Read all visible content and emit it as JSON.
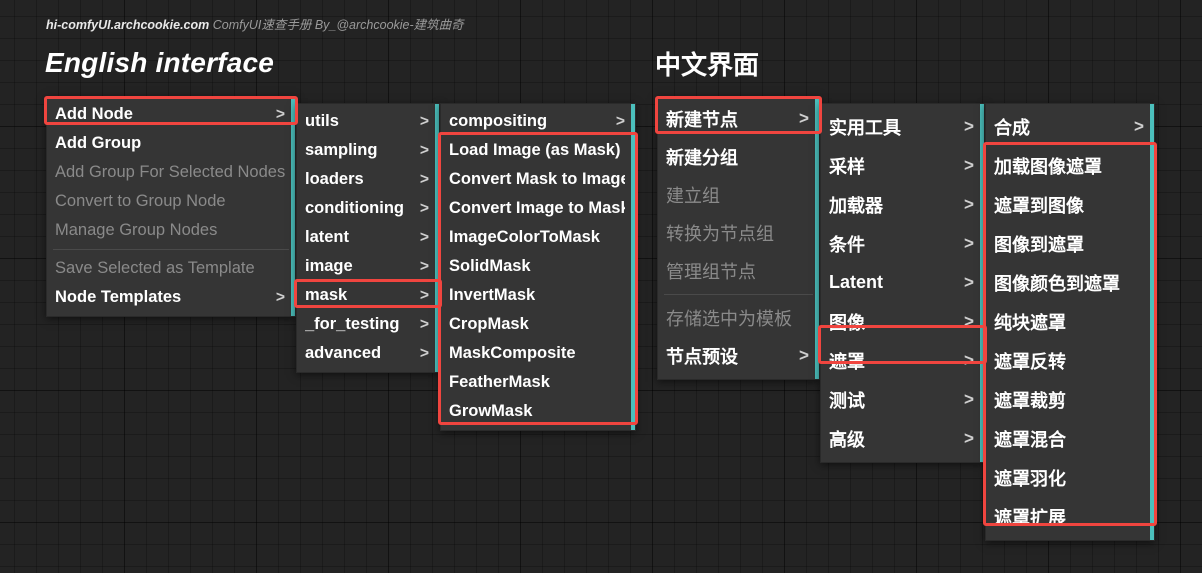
{
  "header": {
    "credit_bold": "hi-comfyUI.archcookie.com",
    "credit_rest": "ComfyUI速查手册 By_@archcookie-建筑曲奇",
    "title_en": "English interface",
    "title_zh": "中文界面"
  },
  "colors": {
    "canvas_bg": "#232323",
    "menu_bg": "#353535",
    "text_enabled": "#ffffff",
    "text_disabled": "#8a8a8a",
    "highlight_box": "#f0453f",
    "accent_strip": "#4bbfbc"
  },
  "icons": {
    "submenu_arrow": ">"
  },
  "english": {
    "column1": {
      "name": "root-context-menu",
      "items": [
        {
          "label": "Add Node",
          "arrow": ">",
          "enabled": true,
          "highlighted": true,
          "accent": true
        },
        {
          "label": "Add Group",
          "arrow": "",
          "enabled": true,
          "highlighted": false,
          "accent": false
        },
        {
          "label": "Add Group For Selected Nodes",
          "arrow": "",
          "enabled": false,
          "highlighted": false,
          "accent": false
        },
        {
          "label": "Convert to Group Node",
          "arrow": "",
          "enabled": false,
          "highlighted": false,
          "accent": false
        },
        {
          "label": "Manage Group Nodes",
          "arrow": "",
          "enabled": false,
          "highlighted": false,
          "accent": false
        },
        {
          "separator": true
        },
        {
          "label": "Save Selected as Template",
          "arrow": "",
          "enabled": false,
          "highlighted": false,
          "accent": false
        },
        {
          "label": "Node Templates",
          "arrow": ">",
          "enabled": true,
          "highlighted": false,
          "accent": true
        }
      ]
    },
    "column2": {
      "name": "add-node-categories",
      "items": [
        {
          "label": "utils",
          "arrow": ">",
          "enabled": true,
          "highlighted": false,
          "accent": true
        },
        {
          "label": "sampling",
          "arrow": ">",
          "enabled": true,
          "highlighted": false,
          "accent": true
        },
        {
          "label": "loaders",
          "arrow": ">",
          "enabled": true,
          "highlighted": false,
          "accent": true
        },
        {
          "label": "conditioning",
          "arrow": ">",
          "enabled": true,
          "highlighted": false,
          "accent": true
        },
        {
          "label": "latent",
          "arrow": ">",
          "enabled": true,
          "highlighted": false,
          "accent": true
        },
        {
          "label": "image",
          "arrow": ">",
          "enabled": true,
          "highlighted": false,
          "accent": true
        },
        {
          "label": "mask",
          "arrow": ">",
          "enabled": true,
          "highlighted": true,
          "accent": true
        },
        {
          "label": "_for_testing",
          "arrow": ">",
          "enabled": true,
          "highlighted": false,
          "accent": true
        },
        {
          "label": "advanced",
          "arrow": ">",
          "enabled": true,
          "highlighted": false,
          "accent": true
        }
      ]
    },
    "column3": {
      "name": "mask-node-list",
      "items": [
        {
          "label": "compositing",
          "arrow": ">",
          "enabled": true,
          "highlighted": false,
          "accent": true,
          "in_box": false
        },
        {
          "label": "Load Image (as Mask)",
          "arrow": "",
          "enabled": true,
          "highlighted": false,
          "accent": false,
          "in_box": true
        },
        {
          "label": "Convert Mask to Image",
          "arrow": "",
          "enabled": true,
          "highlighted": false,
          "accent": false,
          "in_box": true
        },
        {
          "label": "Convert Image to Mask",
          "arrow": "",
          "enabled": true,
          "highlighted": false,
          "accent": false,
          "in_box": true
        },
        {
          "label": "ImageColorToMask",
          "arrow": "",
          "enabled": true,
          "highlighted": false,
          "accent": false,
          "in_box": true
        },
        {
          "label": "SolidMask",
          "arrow": "",
          "enabled": true,
          "highlighted": false,
          "accent": false,
          "in_box": true
        },
        {
          "label": "InvertMask",
          "arrow": "",
          "enabled": true,
          "highlighted": false,
          "accent": false,
          "in_box": true
        },
        {
          "label": "CropMask",
          "arrow": "",
          "enabled": true,
          "highlighted": false,
          "accent": false,
          "in_box": true
        },
        {
          "label": "MaskComposite",
          "arrow": "",
          "enabled": true,
          "highlighted": false,
          "accent": false,
          "in_box": true
        },
        {
          "label": "FeatherMask",
          "arrow": "",
          "enabled": true,
          "highlighted": false,
          "accent": false,
          "in_box": true
        },
        {
          "label": "GrowMask",
          "arrow": "",
          "enabled": true,
          "highlighted": false,
          "accent": false,
          "in_box": true
        }
      ]
    }
  },
  "chinese": {
    "column1": {
      "name": "root-context-menu-zh",
      "items": [
        {
          "label": "新建节点",
          "arrow": ">",
          "enabled": true,
          "highlighted": true,
          "accent": true
        },
        {
          "label": "新建分组",
          "arrow": "",
          "enabled": true,
          "highlighted": false,
          "accent": false
        },
        {
          "label": "建立组",
          "arrow": "",
          "enabled": false,
          "highlighted": false,
          "accent": false
        },
        {
          "label": "转换为节点组",
          "arrow": "",
          "enabled": false,
          "highlighted": false,
          "accent": false
        },
        {
          "label": "管理组节点",
          "arrow": "",
          "enabled": false,
          "highlighted": false,
          "accent": false
        },
        {
          "separator": true
        },
        {
          "label": "存储选中为模板",
          "arrow": "",
          "enabled": false,
          "highlighted": false,
          "accent": false
        },
        {
          "label": "节点预设",
          "arrow": ">",
          "enabled": true,
          "highlighted": false,
          "accent": true
        }
      ]
    },
    "column2": {
      "name": "add-node-categories-zh",
      "items": [
        {
          "label": "实用工具",
          "arrow": ">",
          "enabled": true,
          "highlighted": false,
          "accent": true
        },
        {
          "label": "采样",
          "arrow": ">",
          "enabled": true,
          "highlighted": false,
          "accent": true
        },
        {
          "label": "加载器",
          "arrow": ">",
          "enabled": true,
          "highlighted": false,
          "accent": true
        },
        {
          "label": "条件",
          "arrow": ">",
          "enabled": true,
          "highlighted": false,
          "accent": true
        },
        {
          "label": "Latent",
          "arrow": ">",
          "enabled": true,
          "highlighted": false,
          "accent": true
        },
        {
          "label": "图像",
          "arrow": ">",
          "enabled": true,
          "highlighted": false,
          "accent": true
        },
        {
          "label": "遮罩",
          "arrow": ">",
          "enabled": true,
          "highlighted": true,
          "accent": true
        },
        {
          "label": "测试",
          "arrow": ">",
          "enabled": true,
          "highlighted": false,
          "accent": true
        },
        {
          "label": "高级",
          "arrow": ">",
          "enabled": true,
          "highlighted": false,
          "accent": true
        }
      ]
    },
    "column3": {
      "name": "mask-node-list-zh",
      "items": [
        {
          "label": "合成",
          "arrow": ">",
          "enabled": true,
          "highlighted": false,
          "accent": true,
          "in_box": false
        },
        {
          "label": "加载图像遮罩",
          "arrow": "",
          "enabled": true,
          "highlighted": false,
          "accent": false,
          "in_box": true
        },
        {
          "label": "遮罩到图像",
          "arrow": "",
          "enabled": true,
          "highlighted": false,
          "accent": false,
          "in_box": true
        },
        {
          "label": "图像到遮罩",
          "arrow": "",
          "enabled": true,
          "highlighted": false,
          "accent": false,
          "in_box": true
        },
        {
          "label": "图像颜色到遮罩",
          "arrow": "",
          "enabled": true,
          "highlighted": false,
          "accent": false,
          "in_box": true
        },
        {
          "label": "纯块遮罩",
          "arrow": "",
          "enabled": true,
          "highlighted": false,
          "accent": false,
          "in_box": true
        },
        {
          "label": "遮罩反转",
          "arrow": "",
          "enabled": true,
          "highlighted": false,
          "accent": false,
          "in_box": true
        },
        {
          "label": "遮罩裁剪",
          "arrow": "",
          "enabled": true,
          "highlighted": false,
          "accent": false,
          "in_box": true
        },
        {
          "label": "遮罩混合",
          "arrow": "",
          "enabled": true,
          "highlighted": false,
          "accent": false,
          "in_box": true
        },
        {
          "label": "遮罩羽化",
          "arrow": "",
          "enabled": true,
          "highlighted": false,
          "accent": false,
          "in_box": true
        },
        {
          "label": "遮罩扩展",
          "arrow": "",
          "enabled": true,
          "highlighted": false,
          "accent": false,
          "in_box": true
        }
      ]
    }
  }
}
